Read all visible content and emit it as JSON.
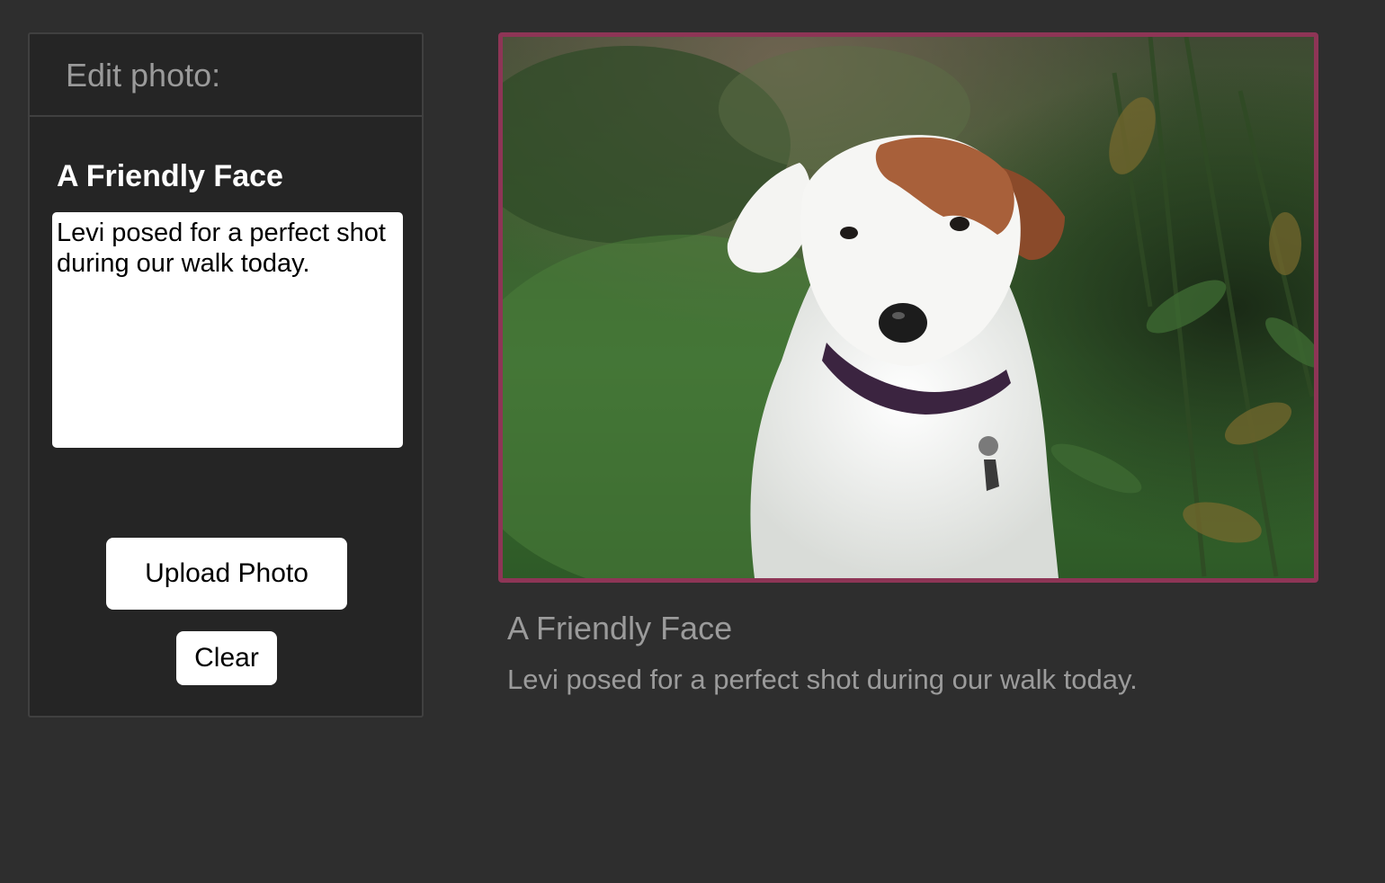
{
  "edit_panel": {
    "header": "Edit photo:",
    "title_value": "A Friendly Face",
    "caption_value": "Levi posed for a perfect shot during our walk today.",
    "upload_label": "Upload Photo",
    "clear_label": "Clear"
  },
  "preview": {
    "title": "A Friendly Face",
    "caption": "Levi posed for a perfect shot during our walk today.",
    "frame_color": "#8e3556"
  },
  "colors": {
    "background": "#2e2e2e",
    "panel": "#252525",
    "muted_text": "#9b9b9b"
  }
}
